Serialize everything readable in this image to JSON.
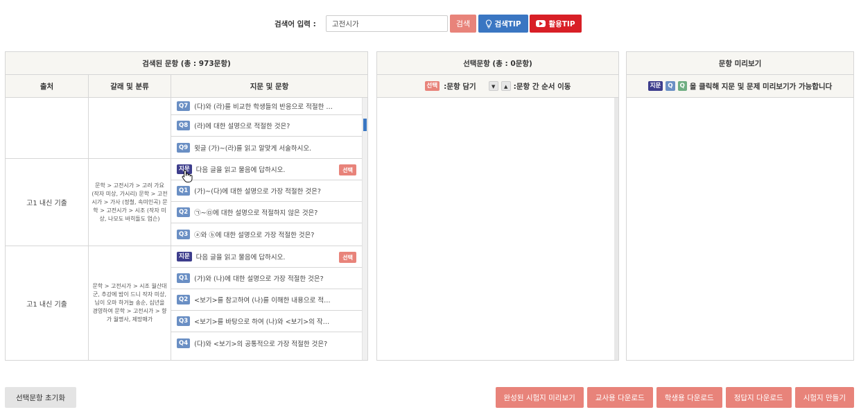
{
  "search": {
    "label": "검색어 입력 :",
    "value": "고전시가",
    "placeholder": "",
    "search_button": "검색",
    "tip_button": "검색TIP",
    "use_tip_button": "활용TIP"
  },
  "left_panel": {
    "title": "검색된 문항 (총 : 973문항)",
    "columns": [
      "출처",
      "갈래 및 분류",
      "지문 및 문항"
    ],
    "groups": [
      {
        "source": "",
        "category": "",
        "rows": [
          {
            "tag": "Q7",
            "text": "(다)와 (라)를 비교한 학생들의 반응으로 적절한 …"
          },
          {
            "tag": "Q8",
            "text": "(라)에 대한 설명으로 적절한 것은?"
          },
          {
            "tag": "Q9",
            "text": "윗글 (가)~(라)를 읽고 알맞게 서술하시오."
          }
        ]
      },
      {
        "source": "고1 내신 기출",
        "category": "문학 > 고전시가 > 고려 가요 (작자 미상, 가시리) 문학 > 고전시가 > 가사 (정철, 속미인곡) 문학 > 고전시가 > 시조 (작자 미상, 나모도 바히돌도 업슨)",
        "rows": [
          {
            "tag": "지문",
            "text": "다음 글을 읽고 물음에 답하시오.",
            "select": "선택"
          },
          {
            "tag": "Q1",
            "text": "(가)~(다)에 대한 설명으로 가장 적절한 것은?"
          },
          {
            "tag": "Q2",
            "text": "㉠~㉤에 대한 설명으로 적절하지 않은 것은?"
          },
          {
            "tag": "Q3",
            "text": "ⓐ와 ⓑ에 대한 설명으로 가장 적절한 것은?"
          }
        ]
      },
      {
        "source": "고1 내신 기출",
        "category": "문학 > 고전시가 > 시조 월산대군, 추강에 밤이 드니 작자 미상, 님이 오마 하거늘 송순, 십년을 경영하여 문학 > 고전시가 > 향가 월명사, 제망매가",
        "rows": [
          {
            "tag": "지문",
            "text": "다음 글을 읽고 물음에 답하시오.",
            "select": "선택"
          },
          {
            "tag": "Q1",
            "text": "(가)와 (나)에 대한 설명으로 가장 적절한 것은?"
          },
          {
            "tag": "Q2",
            "text": "<보기>를 참고하여 (나)를 이해한 내용으로 적절…"
          },
          {
            "tag": "Q3",
            "text": "<보기>를 바탕으로 하여 (나)와 <보기>의 작품을…"
          },
          {
            "tag": "Q4",
            "text": "(다)와 <보기>의 공통적으로 가장 적절한 것은?"
          }
        ]
      }
    ]
  },
  "mid_panel": {
    "title": "선택문항 (총 : 0문항)",
    "select_tag": "선택",
    "select_hint": ":문항 담기",
    "up_arrow": "▼",
    "down_arrow": "▲",
    "order_hint": ":문항 간 순서 이동"
  },
  "right_panel": {
    "title": "문항 미리보기",
    "tag_passage": "지문",
    "tag_q1": "Q",
    "tag_q2": "Q",
    "hint": "을 클릭해 지문 및 문제 미리보기가 가능합니다"
  },
  "bottom": {
    "reset": "선택문항 초기화",
    "actions": [
      "완성된 시험지 미리보기",
      "교사용 다운로드",
      "학생용 다운로드",
      "정답지 다운로드",
      "시험지 만들기"
    ]
  },
  "colors": {
    "accent_coral": "#e8837a",
    "accent_blue": "#3a76c2",
    "accent_red": "#d81f26",
    "passage_tag": "#3d3d8c",
    "question_tag": "#6a8fc4"
  }
}
